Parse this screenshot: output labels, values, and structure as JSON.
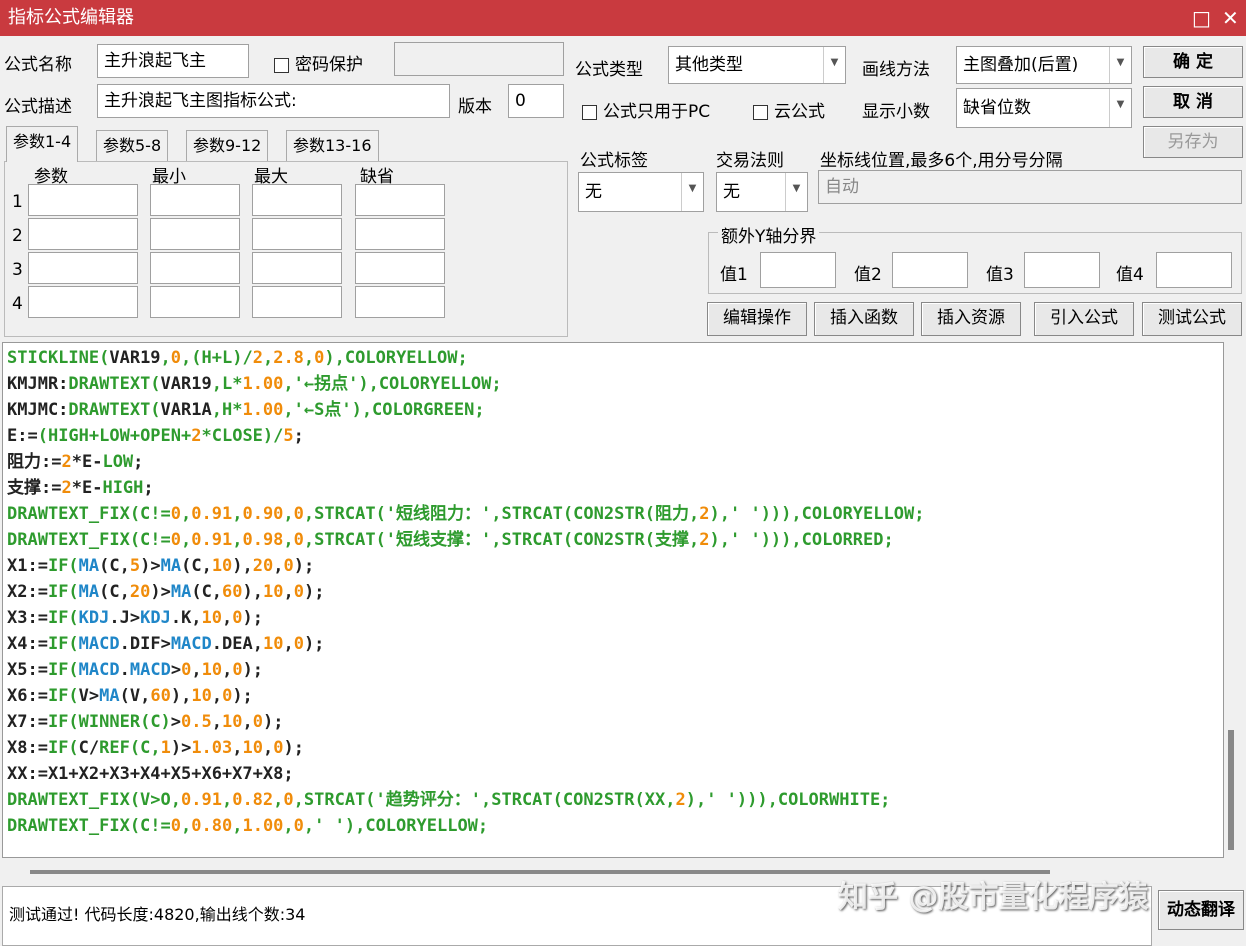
{
  "window": {
    "title": "指标公式编辑器",
    "min": "□",
    "close": "✕"
  },
  "form": {
    "name_label": "公式名称",
    "name_value": "主升浪起飞主",
    "password_label": "密码保护",
    "desc_label": "公式描述",
    "desc_value": "主升浪起飞主图指标公式:",
    "version_label": "版本",
    "version_value": "0",
    "type_label": "公式类型",
    "type_value": "其他类型",
    "draw_label": "画线方法",
    "draw_value": "主图叠加(后置)",
    "pc_only_label": "公式只用于PC",
    "cloud_label": "云公式",
    "decimal_label": "显示小数",
    "decimal_value": "缺省位数",
    "tag_label": "公式标签",
    "tag_value": "无",
    "rule_label": "交易法则",
    "rule_value": "无",
    "axis_label": "坐标线位置,最多6个,用分号分隔",
    "axis_placeholder": "自动",
    "yaxis_group": "额外Y轴分界",
    "y_values": [
      "值1",
      "值2",
      "值3",
      "值4"
    ]
  },
  "buttons": {
    "ok": "确  定",
    "cancel": "取  消",
    "save_as": "另存为",
    "edit_ops": "编辑操作",
    "insert_func": "插入函数",
    "insert_res": "插入资源",
    "import": "引入公式",
    "test": "测试公式",
    "translate": "动态翻译"
  },
  "params": {
    "tabs": [
      "参数1-4",
      "参数5-8",
      "参数9-12",
      "参数13-16"
    ],
    "headers": [
      "参数",
      "最小",
      "最大",
      "缺省"
    ],
    "rows": [
      "1",
      "2",
      "3",
      "4"
    ]
  },
  "code_lines": [
    [
      [
        "STICKLINE(",
        "g"
      ],
      [
        "VAR19",
        "k"
      ],
      [
        ",",
        "g"
      ],
      [
        "0",
        "o"
      ],
      [
        ",(H+L)/",
        "g"
      ],
      [
        "2",
        "o"
      ],
      [
        ",",
        "g"
      ],
      [
        "2.8",
        "o"
      ],
      [
        ",",
        "g"
      ],
      [
        "0",
        "o"
      ],
      [
        "),COLORYELLOW;",
        "g"
      ]
    ],
    [
      [
        "KMJMR:",
        "k"
      ],
      [
        "DRAWTEXT(",
        "g"
      ],
      [
        "VAR19",
        "k"
      ],
      [
        ",L*",
        "g"
      ],
      [
        "1.00",
        "o"
      ],
      [
        ",'←拐点'),COLORYELLOW;",
        "g"
      ]
    ],
    [
      [
        "KMJMC:",
        "k"
      ],
      [
        "DRAWTEXT(",
        "g"
      ],
      [
        "VAR1A",
        "k"
      ],
      [
        ",H*",
        "g"
      ],
      [
        "1.00",
        "o"
      ],
      [
        ",'←S点'),COLORGREEN;",
        "g"
      ]
    ],
    [
      [
        "E:=",
        "k"
      ],
      [
        "(HIGH+LOW+OPEN+",
        "g"
      ],
      [
        "2",
        "o"
      ],
      [
        "*CLOSE)/",
        "g"
      ],
      [
        "5",
        "o"
      ],
      [
        ";",
        "k"
      ]
    ],
    [
      [
        "阻力:=",
        "k"
      ],
      [
        "2",
        "o"
      ],
      [
        "*E-",
        "k"
      ],
      [
        "LOW",
        "g"
      ],
      [
        ";",
        "k"
      ]
    ],
    [
      [
        "支撑:=",
        "k"
      ],
      [
        "2",
        "o"
      ],
      [
        "*E-",
        "k"
      ],
      [
        "HIGH",
        "g"
      ],
      [
        ";",
        "k"
      ]
    ],
    [
      [
        "DRAWTEXT_FIX(C!=",
        "g"
      ],
      [
        "0",
        "o"
      ],
      [
        ",",
        "g"
      ],
      [
        "0.91",
        "o"
      ],
      [
        ",",
        "g"
      ],
      [
        "0.90",
        "o"
      ],
      [
        ",",
        "g"
      ],
      [
        "0",
        "o"
      ],
      [
        ",STRCAT('短线阻力：',STRCAT(CON2STR(阻力,",
        "g"
      ],
      [
        "2",
        "o"
      ],
      [
        "),' '))),COLORYELLOW;",
        "g"
      ]
    ],
    [
      [
        "DRAWTEXT_FIX(C!=",
        "g"
      ],
      [
        "0",
        "o"
      ],
      [
        ",",
        "g"
      ],
      [
        "0.91",
        "o"
      ],
      [
        ",",
        "g"
      ],
      [
        "0.98",
        "o"
      ],
      [
        ",",
        "g"
      ],
      [
        "0",
        "o"
      ],
      [
        ",STRCAT('短线支撑：',STRCAT(CON2STR(支撑,",
        "g"
      ],
      [
        "2",
        "o"
      ],
      [
        "),' '))),COLORRED;",
        "g"
      ]
    ],
    [
      [
        "X1:=",
        "k"
      ],
      [
        "IF(",
        "g"
      ],
      [
        "MA",
        "b"
      ],
      [
        "(C,",
        "k"
      ],
      [
        "5",
        "o"
      ],
      [
        ")>",
        "k"
      ],
      [
        "MA",
        "b"
      ],
      [
        "(C,",
        "k"
      ],
      [
        "10",
        "o"
      ],
      [
        "),",
        "k"
      ],
      [
        "20",
        "o"
      ],
      [
        ",",
        "k"
      ],
      [
        "0",
        "o"
      ],
      [
        ");",
        "k"
      ]
    ],
    [
      [
        "X2:=",
        "k"
      ],
      [
        "IF(",
        "g"
      ],
      [
        "MA",
        "b"
      ],
      [
        "(C,",
        "k"
      ],
      [
        "20",
        "o"
      ],
      [
        ")>",
        "k"
      ],
      [
        "MA",
        "b"
      ],
      [
        "(C,",
        "k"
      ],
      [
        "60",
        "o"
      ],
      [
        "),",
        "k"
      ],
      [
        "10",
        "o"
      ],
      [
        ",",
        "k"
      ],
      [
        "0",
        "o"
      ],
      [
        ");",
        "k"
      ]
    ],
    [
      [
        "X3:=",
        "k"
      ],
      [
        "IF(",
        "g"
      ],
      [
        "KDJ",
        "b"
      ],
      [
        ".J>",
        "k"
      ],
      [
        "KDJ",
        "b"
      ],
      [
        ".K,",
        "k"
      ],
      [
        "10",
        "o"
      ],
      [
        ",",
        "k"
      ],
      [
        "0",
        "o"
      ],
      [
        ");",
        "k"
      ]
    ],
    [
      [
        "X4:=",
        "k"
      ],
      [
        "IF(",
        "g"
      ],
      [
        "MACD",
        "b"
      ],
      [
        ".DIF>",
        "k"
      ],
      [
        "MACD",
        "b"
      ],
      [
        ".DEA,",
        "k"
      ],
      [
        "10",
        "o"
      ],
      [
        ",",
        "k"
      ],
      [
        "0",
        "o"
      ],
      [
        ");",
        "k"
      ]
    ],
    [
      [
        "X5:=",
        "k"
      ],
      [
        "IF(",
        "g"
      ],
      [
        "MACD",
        "b"
      ],
      [
        ".",
        "k"
      ],
      [
        "MACD",
        "b"
      ],
      [
        ">",
        "k"
      ],
      [
        "0",
        "o"
      ],
      [
        ",",
        "k"
      ],
      [
        "10",
        "o"
      ],
      [
        ",",
        "k"
      ],
      [
        "0",
        "o"
      ],
      [
        ");",
        "k"
      ]
    ],
    [
      [
        "X6:=",
        "k"
      ],
      [
        "IF(",
        "g"
      ],
      [
        "V>",
        "k"
      ],
      [
        "MA",
        "b"
      ],
      [
        "(V,",
        "k"
      ],
      [
        "60",
        "o"
      ],
      [
        "),",
        "k"
      ],
      [
        "10",
        "o"
      ],
      [
        ",",
        "k"
      ],
      [
        "0",
        "o"
      ],
      [
        ");",
        "k"
      ]
    ],
    [
      [
        "X7:=",
        "k"
      ],
      [
        "IF(",
        "g"
      ],
      [
        "WINNER(C)",
        "g"
      ],
      [
        ">",
        "k"
      ],
      [
        "0.5",
        "o"
      ],
      [
        ",",
        "k"
      ],
      [
        "10",
        "o"
      ],
      [
        ",",
        "k"
      ],
      [
        "0",
        "o"
      ],
      [
        ");",
        "k"
      ]
    ],
    [
      [
        "X8:=",
        "k"
      ],
      [
        "IF(",
        "g"
      ],
      [
        "C/",
        "k"
      ],
      [
        "REF(C,",
        "g"
      ],
      [
        "1",
        "o"
      ],
      [
        ")>",
        "k"
      ],
      [
        "1.03",
        "o"
      ],
      [
        ",",
        "k"
      ],
      [
        "10",
        "o"
      ],
      [
        ",",
        "k"
      ],
      [
        "0",
        "o"
      ],
      [
        ");",
        "k"
      ]
    ],
    [
      [
        "XX:=X1+X2+X3+X4+X5+X6+X7+X8;",
        "k"
      ]
    ],
    [
      [
        "DRAWTEXT_FIX(V>O,",
        "g"
      ],
      [
        "0.91",
        "o"
      ],
      [
        ",",
        "g"
      ],
      [
        "0.82",
        "o"
      ],
      [
        ",",
        "g"
      ],
      [
        "0",
        "o"
      ],
      [
        ",STRCAT('趋势评分：',STRCAT(CON2STR(XX,",
        "g"
      ],
      [
        "2",
        "o"
      ],
      [
        "),' '))),COLORWHITE;",
        "g"
      ]
    ],
    [
      [
        "DRAWTEXT_FIX(C!=",
        "g"
      ],
      [
        "0",
        "o"
      ],
      [
        ",",
        "g"
      ],
      [
        "0.80",
        "o"
      ],
      [
        ",",
        "g"
      ],
      [
        "1.00",
        "o"
      ],
      [
        ",",
        "g"
      ],
      [
        "0",
        "o"
      ],
      [
        ",' '),COLORYELLOW;",
        "g"
      ]
    ]
  ],
  "status": "测试通过! 代码长度:4820,输出线个数:34",
  "watermark": "知乎 @股市量化程序猿"
}
